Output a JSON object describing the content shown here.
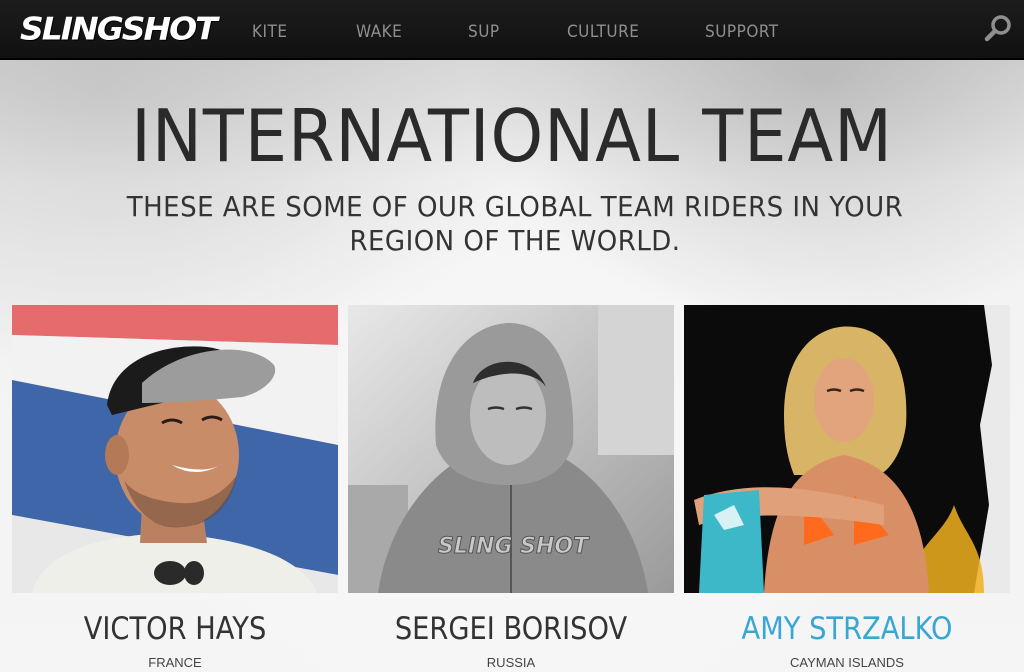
{
  "brand": {
    "logo_text": "SLINGSHOT"
  },
  "nav": {
    "items": [
      {
        "label": "KITE"
      },
      {
        "label": "WAKE"
      },
      {
        "label": "SUP"
      },
      {
        "label": "CULTURE"
      },
      {
        "label": "SUPPORT"
      }
    ],
    "search_icon": "search-icon"
  },
  "header": {
    "title": "INTERNATIONAL TEAM",
    "subtitle": "THESE ARE SOME OF OUR GLOBAL TEAM RIDERS IN YOUR REGION OF THE WORLD."
  },
  "riders": [
    {
      "name": "VICTOR HAYS",
      "country": "FRANCE"
    },
    {
      "name": "SERGEI BORISOV",
      "country": "RUSSIA"
    },
    {
      "name": "AMY STRZALKO",
      "country": "CAYMAN ISLANDS"
    }
  ],
  "colors": {
    "nav_bg": "#161616",
    "nav_text": "#8f8f8f",
    "highlight_name": "#3aa6d3",
    "title_text": "#2a2a2a"
  }
}
